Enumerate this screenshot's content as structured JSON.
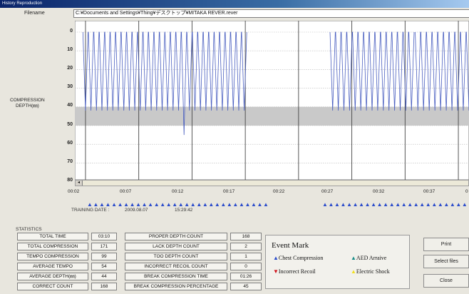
{
  "window": {
    "title": "History Reproduction"
  },
  "file": {
    "label": "Filename",
    "path": "C:¥Documents and Settings¥Thing¥デスクトップ¥MITAKA REVER.rever"
  },
  "chart_data": {
    "type": "line",
    "ylabel_line1": "COMPRESSION",
    "ylabel_line2": "DEPTH(㎜)",
    "y_ticks": [
      "0",
      "10",
      "20",
      "30",
      "40",
      "50",
      "60",
      "70",
      "80"
    ],
    "ylim": [
      0,
      85
    ],
    "y_inverted": true,
    "target_band": [
      40,
      50
    ],
    "x_ticks": [
      "00:02",
      "00:07",
      "00:12",
      "00:17",
      "00:22",
      "00:27",
      "00:32",
      "00:37",
      "0"
    ],
    "x_range": [
      "00:02",
      "00:39"
    ],
    "series": [
      {
        "compression_blocks": [
          {
            "start_s": 3.0,
            "end_s": 17.9,
            "count": 30,
            "depth_mm": 42,
            "outliers": [
              {
                "index": 18,
                "depth_mm": 55
              }
            ]
          },
          {
            "start_s": 26.2,
            "end_s": 33.6,
            "count": 15,
            "depth_mm": 42
          },
          {
            "start_s": 34.2,
            "end_s": 39.0,
            "count": 10,
            "depth_mm": 42
          }
        ]
      }
    ],
    "grid": true
  },
  "scrollbar": {
    "left_arrow": "◂"
  },
  "training": {
    "label": "TRAINING DATE :",
    "date": "2009.08.07",
    "time": "15:29:42"
  },
  "markers": {
    "row1": "▲▲▲▲▲▲▲▲▲▲▲▲▲▲▲▲▲▲▲▲▲▲▲▲▲▲▲▲▲▲",
    "row2": "▲▲▲▲▲▲▲▲▲▲▲▲▲▲▲▲▲▲▲▲▲▲▲▲▲▲"
  },
  "statistics": {
    "title": "STATISTICS",
    "left": [
      {
        "label": "TOTAL TIME",
        "value": "03:10"
      },
      {
        "label": "TOTAL COMPRESSION",
        "value": "171"
      },
      {
        "label": "TEMPO COMPRESSION",
        "value": "99"
      },
      {
        "label": "AVERAGE TEMPO",
        "value": "54"
      },
      {
        "label": "AVERAGE DEPTH(㎜)",
        "value": "44"
      },
      {
        "label": "CORRECT COUNT",
        "value": "168"
      }
    ],
    "right": [
      {
        "label": "PROPER DEPTH COUNT",
        "value": "168"
      },
      {
        "label": "LACK DEPTH COUNT",
        "value": "2"
      },
      {
        "label": "TOO DEPTH COUNT",
        "value": "1"
      },
      {
        "label": "INCORRECT RECOIL COUNT",
        "value": "0"
      },
      {
        "label": "BREAK COMPRESSION TIME",
        "value": "01:26"
      },
      {
        "label": "BREAK COMPRESSION PERCENTAGE",
        "value": "45"
      }
    ]
  },
  "event_mark": {
    "title": "Event Mark",
    "chest": "Chest  Compression",
    "aed": "AED Arraive",
    "recoil": "Incorrect Recoil",
    "shock": "Electric Shock",
    "colors": {
      "chest": "#2b4ccb",
      "aed": "#1a8f8a",
      "recoil": "#d0121b",
      "shock": "#f2e021"
    }
  },
  "buttons": {
    "print": "Print",
    "select": "Select files",
    "close": "Close"
  }
}
